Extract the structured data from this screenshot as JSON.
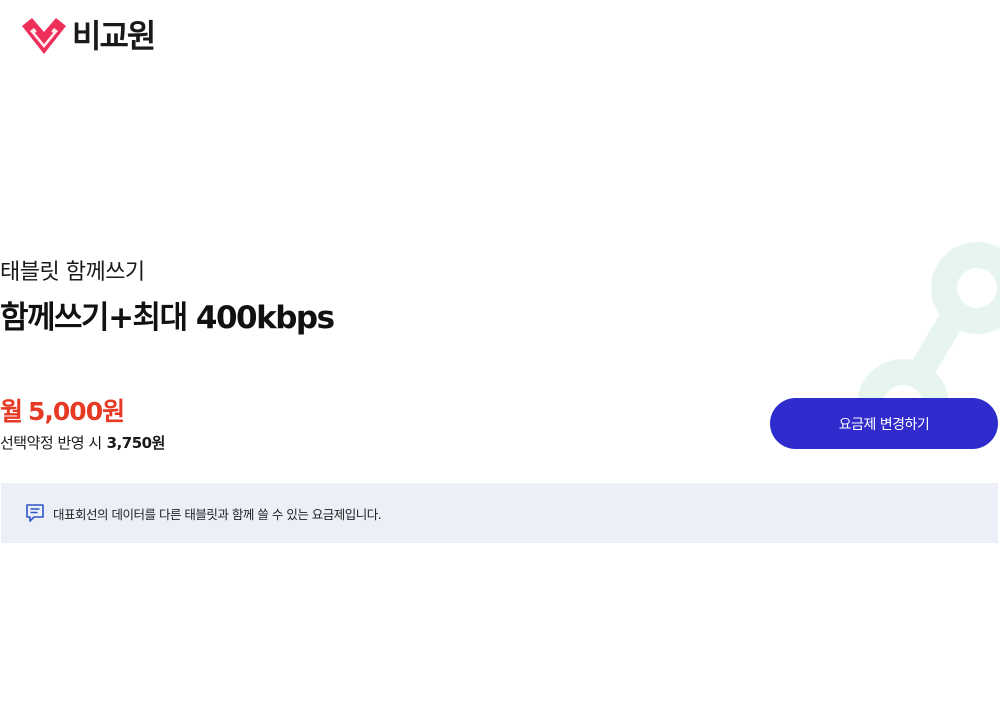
{
  "header": {
    "logo_text": "비교원",
    "logo_icon": "heart-v-logo-icon",
    "brand_color": "#ee2f5a"
  },
  "plan": {
    "category": "태블릿 함께쓰기",
    "name": "함께쓰기+최대 400kbps",
    "price_prefix": "월",
    "price": "5,000원",
    "discount_label": "선택약정 반영 시",
    "discount_price": "3,750원",
    "price_color": "#e63a25"
  },
  "actions": {
    "change_plan_label": "요금제 변경하기",
    "button_color": "#2f2bcc"
  },
  "notice": {
    "icon": "message-icon",
    "text": "대표회선의 데이터를 다른 태블릿과 함께 쓸 수 있는 요금제입니다.",
    "background_color": "#eceff8"
  },
  "decoration": {
    "icon": "share-network-icon",
    "color": "#e6f6ee"
  }
}
